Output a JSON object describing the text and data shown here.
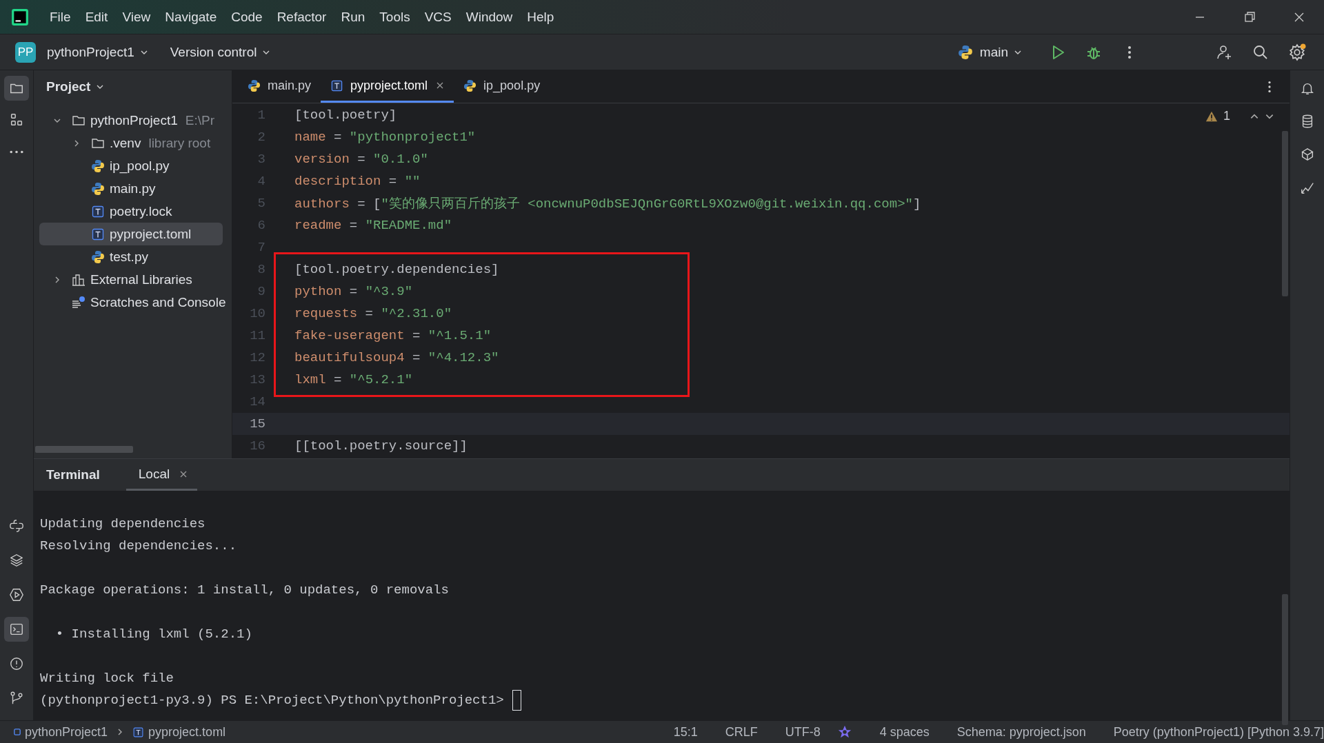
{
  "window": {
    "menu": [
      "File",
      "Edit",
      "View",
      "Navigate",
      "Code",
      "Refactor",
      "Run",
      "Tools",
      "VCS",
      "Window",
      "Help"
    ]
  },
  "toolbar": {
    "project_badge": "PP",
    "project": "pythonProject1",
    "vcs": "Version control",
    "run_config": "main"
  },
  "left_tools": [
    {
      "kind": "folder",
      "selected": true
    },
    {
      "kind": "structure",
      "selected": false
    },
    {
      "kind": "more",
      "selected": false
    }
  ],
  "left_tools_bottom": [
    {
      "kind": "python-console",
      "selected": false
    },
    {
      "kind": "layers",
      "selected": false
    },
    {
      "kind": "services",
      "selected": false
    },
    {
      "kind": "terminal",
      "selected": true
    },
    {
      "kind": "problems",
      "selected": false
    },
    {
      "kind": "git",
      "selected": false
    }
  ],
  "right_tools": [
    {
      "kind": "bell"
    },
    {
      "kind": "database"
    },
    {
      "kind": "ai"
    },
    {
      "kind": "chart"
    }
  ],
  "project_panel": {
    "title": "Project",
    "tree": [
      {
        "label": "pythonProject1",
        "hint": "E:\\Pr",
        "kind": "folder",
        "expanded": true,
        "selected": false,
        "children": [
          {
            "label": ".venv",
            "hint": "library root",
            "kind": "folder",
            "expanded": false,
            "selected": false
          },
          {
            "label": "ip_pool.py",
            "kind": "python",
            "selected": false
          },
          {
            "label": "main.py",
            "kind": "python",
            "selected": false
          },
          {
            "label": "poetry.lock",
            "kind": "toml",
            "selected": false
          },
          {
            "label": "pyproject.toml",
            "kind": "toml",
            "selected": true
          },
          {
            "label": "test.py",
            "kind": "python",
            "selected": false
          }
        ]
      },
      {
        "label": "External Libraries",
        "kind": "libraries",
        "expanded": false,
        "selected": false
      },
      {
        "label": "Scratches and Console",
        "kind": "scratches",
        "selected": false
      }
    ]
  },
  "editor": {
    "tabs": [
      {
        "label": "main.py",
        "kind": "python",
        "selected": false
      },
      {
        "label": "pyproject.toml",
        "kind": "toml",
        "selected": true
      },
      {
        "label": "ip_pool.py",
        "kind": "python",
        "selected": false
      }
    ],
    "warnings": "1",
    "lines": [
      {
        "number": "1",
        "current": false,
        "boxed": false,
        "tokens": [
          {
            "kind": "header",
            "text": "[tool.poetry]"
          }
        ]
      },
      {
        "number": "2",
        "current": false,
        "boxed": false,
        "tokens": [
          {
            "kind": "key",
            "text": "name"
          },
          {
            "kind": "punct",
            "text": " = "
          },
          {
            "kind": "string",
            "text": "\"pythonproject1\""
          }
        ]
      },
      {
        "number": "3",
        "current": false,
        "boxed": false,
        "tokens": [
          {
            "kind": "key",
            "text": "version"
          },
          {
            "kind": "punct",
            "text": " = "
          },
          {
            "kind": "string",
            "text": "\"0.1.0\""
          }
        ]
      },
      {
        "number": "4",
        "current": false,
        "boxed": false,
        "tokens": [
          {
            "kind": "key",
            "text": "description"
          },
          {
            "kind": "punct",
            "text": " = "
          },
          {
            "kind": "string",
            "text": "\"\""
          }
        ]
      },
      {
        "number": "5",
        "current": false,
        "boxed": false,
        "tokens": [
          {
            "kind": "key",
            "text": "authors"
          },
          {
            "kind": "punct",
            "text": " = ["
          },
          {
            "kind": "string",
            "text": "\"笑的像只两百斤的孩子 <oncwnuP0dbSEJQnGrG0RtL9XOzw0@git.weixin.qq.com>\""
          },
          {
            "kind": "punct",
            "text": "]"
          }
        ]
      },
      {
        "number": "6",
        "current": false,
        "boxed": false,
        "tokens": [
          {
            "kind": "key",
            "text": "readme"
          },
          {
            "kind": "punct",
            "text": " = "
          },
          {
            "kind": "string",
            "text": "\"README.md\""
          }
        ]
      },
      {
        "number": "7",
        "current": false,
        "boxed": false
      },
      {
        "number": "8",
        "current": false,
        "boxed": true,
        "tokens": [
          {
            "kind": "header",
            "text": "[tool.poetry.dependencies]"
          }
        ]
      },
      {
        "number": "9",
        "current": false,
        "boxed": true,
        "tokens": [
          {
            "kind": "key",
            "text": "python"
          },
          {
            "kind": "punct",
            "text": " = "
          },
          {
            "kind": "string",
            "text": "\"^3.9\""
          }
        ]
      },
      {
        "number": "10",
        "current": false,
        "boxed": true,
        "tokens": [
          {
            "kind": "key",
            "text": "requests"
          },
          {
            "kind": "punct",
            "text": " = "
          },
          {
            "kind": "string",
            "text": "\"^2.31.0\""
          }
        ]
      },
      {
        "number": "11",
        "current": false,
        "boxed": true,
        "tokens": [
          {
            "kind": "key",
            "text": "fake-useragent"
          },
          {
            "kind": "punct",
            "text": " = "
          },
          {
            "kind": "string",
            "text": "\"^1.5.1\""
          }
        ]
      },
      {
        "number": "12",
        "current": false,
        "boxed": true,
        "tokens": [
          {
            "kind": "key",
            "text": "beautifulsoup4"
          },
          {
            "kind": "punct",
            "text": " = "
          },
          {
            "kind": "string",
            "text": "\"^4.12.3\""
          }
        ]
      },
      {
        "number": "13",
        "current": false,
        "boxed": true,
        "tokens": [
          {
            "kind": "key",
            "text": "lxml"
          },
          {
            "kind": "punct",
            "text": " = "
          },
          {
            "kind": "string",
            "text": "\"^5.2.1\""
          }
        ]
      },
      {
        "number": "14",
        "current": false,
        "boxed": false
      },
      {
        "number": "15",
        "current": true,
        "boxed": false
      },
      {
        "number": "16",
        "current": false,
        "boxed": false,
        "tokens": [
          {
            "kind": "header",
            "text": "[[tool.poetry.source]]"
          }
        ]
      }
    ]
  },
  "terminal": {
    "title": "Terminal",
    "tabs": [
      {
        "label": "Local",
        "selected": true
      }
    ],
    "blocks": [
      [
        "Updating dependencies",
        "Resolving dependencies..."
      ],
      [
        "Package operations: 1 install, 0 updates, 0 removals"
      ],
      [
        "  • Installing lxml (5.2.1)"
      ],
      [
        "Writing lock file"
      ]
    ],
    "prompt": "(pythonproject1-py3.9) PS E:\\Project\\Python\\pythonProject1>"
  },
  "status_bar": {
    "breadcrumb": [
      {
        "label": "pythonProject1",
        "kind": "module"
      },
      {
        "label": "pyproject.toml",
        "kind": "toml"
      }
    ],
    "items": [
      {
        "kind": "text",
        "text": "15:1"
      },
      {
        "kind": "text",
        "text": "CRLF"
      },
      {
        "kind": "text",
        "text": "UTF-8"
      },
      {
        "kind": "icon"
      },
      {
        "kind": "text",
        "text": "4 spaces"
      },
      {
        "kind": "text",
        "text": "Schema: pyproject.json"
      },
      {
        "kind": "text",
        "text": "Poetry (pythonProject1) [Python 3.9.7]"
      }
    ]
  }
}
